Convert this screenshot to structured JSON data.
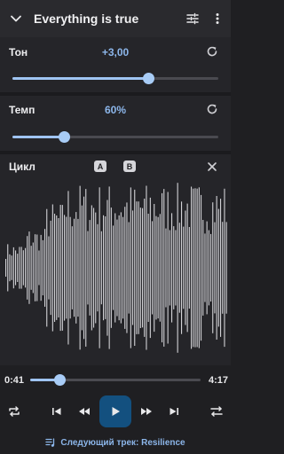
{
  "appbar": {
    "title": "Everything is true"
  },
  "pitch": {
    "label": "Тон",
    "value": "+3,00",
    "level": 0.66
  },
  "tempo": {
    "label": "Темп",
    "value": "60%",
    "level": 0.25
  },
  "loop": {
    "label": "Цикл",
    "a_label": "A",
    "b_label": "B"
  },
  "player": {
    "current_time": "0:41",
    "total_time": "4:17",
    "progress": 0.17
  },
  "next_track": {
    "text": "Следующий трек: Resilience"
  },
  "colors": {
    "accent": "#9fc4f2",
    "play_button": "#13507f",
    "background": "#1f1f22"
  }
}
